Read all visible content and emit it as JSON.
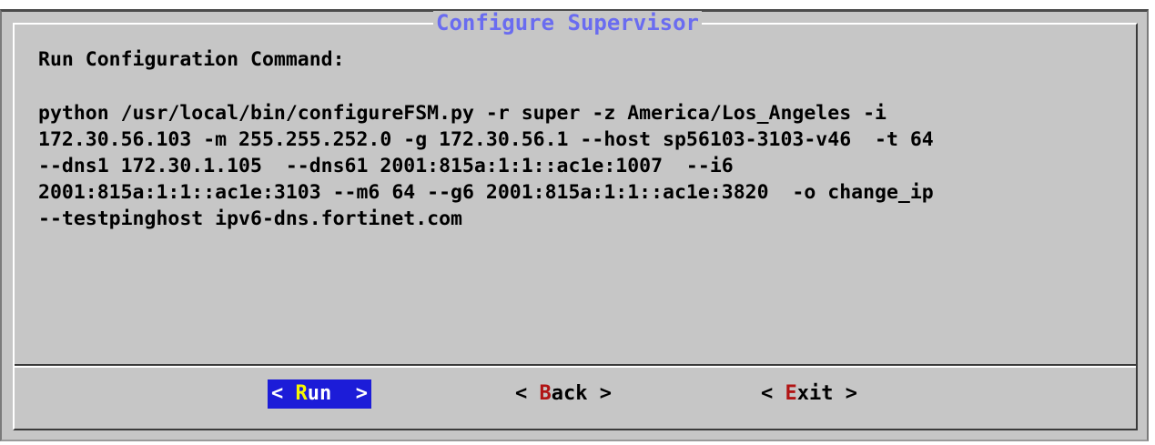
{
  "dialog": {
    "title": "Configure Supervisor",
    "heading": "Run Configuration Command:",
    "command_lines": [
      "python /usr/local/bin/configureFSM.py -r super -z America/Los_Angeles -i",
      "172.30.56.103 -m 255.255.252.0 -g 172.30.56.1 --host sp56103-3103-v46  -t 64",
      "--dns1 172.30.1.105  --dns61 2001:815a:1:1::ac1e:1007  --i6",
      "2001:815a:1:1::ac1e:3103 --m6 64 --g6 2001:815a:1:1::ac1e:3820  -o change_ip",
      "--testpinghost ipv6-dns.fortinet.com"
    ]
  },
  "buttons": {
    "run": {
      "open": "< ",
      "hot": "R",
      "rest": "un",
      "close": "  >"
    },
    "back": {
      "open": "< ",
      "hot": "B",
      "rest": "ack",
      "close": " >"
    },
    "exit": {
      "open": "< ",
      "hot": "E",
      "rest": "xit",
      "close": " >"
    }
  },
  "colors": {
    "background": "#c6c6c6",
    "title": "#6a6cf0",
    "selected_button": "#1c1cd8",
    "hotkey": "#b11414",
    "selected_hotkey": "#f7f700"
  }
}
